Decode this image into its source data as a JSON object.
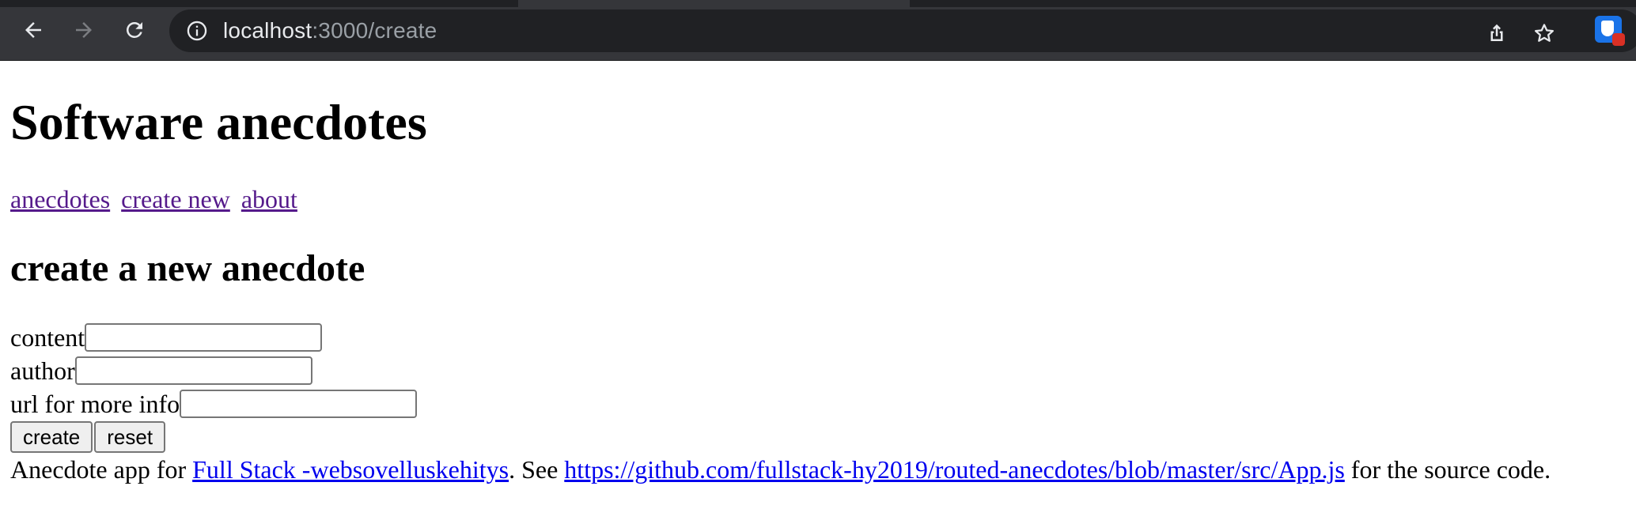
{
  "browser": {
    "url_host": "localhost",
    "url_rest": ":3000/create",
    "icons": {
      "back": "arrow-left-icon",
      "forward": "arrow-right-icon",
      "reload": "reload-icon",
      "site_info": "info-icon",
      "share": "share-icon",
      "bookmark": "star-icon",
      "extension": "extension-icon"
    }
  },
  "page": {
    "title": "Software anecdotes",
    "nav": [
      "anecdotes",
      "create new",
      "about"
    ],
    "form_heading": "create a new anecdote",
    "fields": {
      "content_label": "content",
      "content_value": "",
      "author_label": "author",
      "author_value": "",
      "url_label": "url for more info",
      "url_value": ""
    },
    "buttons": {
      "create": "create",
      "reset": "reset"
    },
    "footer": {
      "prefix": "Anecdote app for ",
      "course_link": "Full Stack -websovelluskehitys",
      "middle": ". See ",
      "source_link": "https://github.com/fullstack-hy2019/routed-anecdotes/blob/master/src/App.js",
      "suffix": " for the source code."
    }
  },
  "colors": {
    "chrome_bg": "#35363a",
    "omnibox_bg": "#202124",
    "visited_link": "#551a8b",
    "link": "#0000ee"
  }
}
